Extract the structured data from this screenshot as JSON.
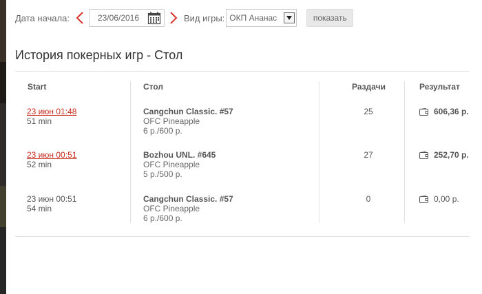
{
  "filters": {
    "start_date_label": "Дата начала:",
    "start_date_value": "23/06/2016",
    "game_type_label": "Вид игры:",
    "game_type_value": "ОКП Ананас",
    "show_button": "показать"
  },
  "page_title": "История покерных игр - Стол",
  "table": {
    "headers": {
      "start": "Start",
      "table": "Стол",
      "hands": "Раздачи",
      "result": "Результат"
    },
    "rows": [
      {
        "start": "23 июн 01:48",
        "duration": "51 min",
        "start_is_link": true,
        "table_name": "Cangchun Classic. #57",
        "game": "OFC Pineapple",
        "stakes": "6 р./600 р.",
        "hands": "25",
        "result": "606,36 р."
      },
      {
        "start": "23 июн 00:51",
        "duration": "52 min",
        "start_is_link": true,
        "table_name": "Bozhou UNL. #645",
        "game": "OFC Pineapple",
        "stakes": "5 р./500 р.",
        "hands": "27",
        "result": "252,70 р."
      },
      {
        "start": "23 июн 00:51",
        "duration": "54 min",
        "start_is_link": false,
        "table_name": "Cangchun Classic. #57",
        "game": "OFC Pineapple",
        "stakes": "6 р./600 р.",
        "hands": "0",
        "result": "0,00 р."
      }
    ]
  },
  "colors": {
    "accent_red": "#c8291d",
    "text": "#555555",
    "rule": "#e2e2e2"
  },
  "icons": {
    "prev": "chevron-left-icon",
    "next": "chevron-right-icon",
    "calendar": "calendar-icon",
    "dropdown": "dropdown-arrow-icon",
    "result": "wallet-icon"
  }
}
